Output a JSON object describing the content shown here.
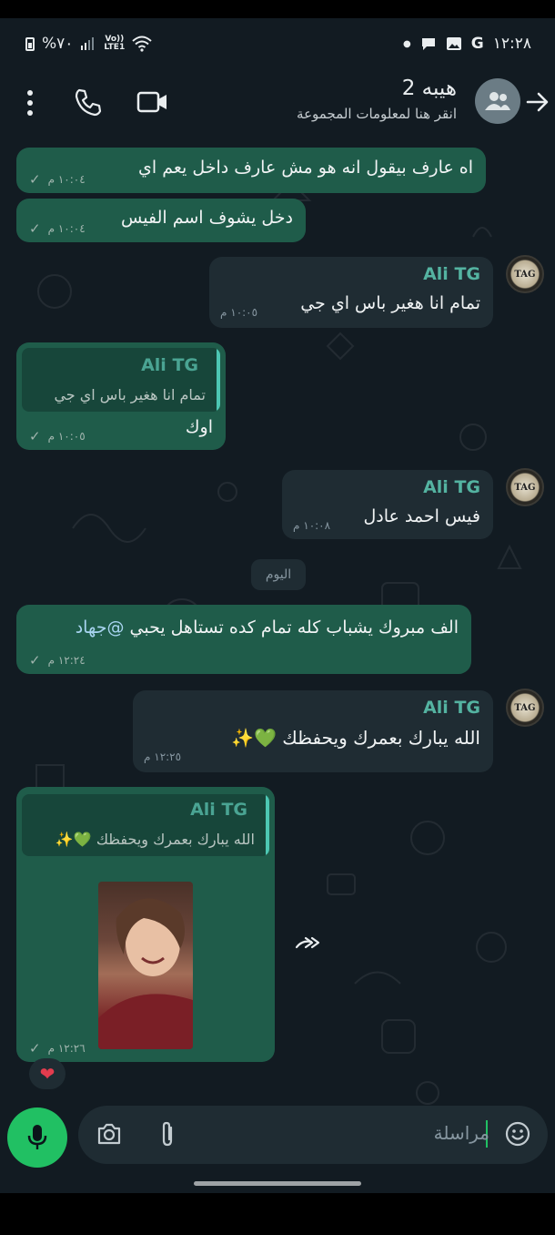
{
  "status_bar": {
    "time": "١٢:٢٨",
    "battery": "%٧٠",
    "network": "LTE1",
    "volte": "Vo))",
    "carrier_icon": "G"
  },
  "header": {
    "group_name": "هيبه 2",
    "subtitle": "انقر هنا لمعلومات المجموعة"
  },
  "messages": [
    {
      "text": "اه عارف بيقول انه هو مش عارف داخل يعم اي",
      "time": "١٠:٠٤ م"
    },
    {
      "text": "دخل يشوف اسم الفيس",
      "time": "١٠:٠٤ م"
    },
    {
      "sender": "Ali TG",
      "text": "تمام  انا هغير باس اي جي",
      "time": "١٠:٠٥ م"
    },
    {
      "quote_sender": "Ali TG",
      "quote_text": "تمام  انا هغير باس اي جي",
      "text": "اوك",
      "time": "١٠:٠٥ م"
    },
    {
      "sender": "Ali TG",
      "text": "فيس احمد عادل",
      "time": "١٠:٠٨ م"
    },
    {
      "text_before": "الف مبروك يشباب كله تمام كده تستاهل يحبي ",
      "mention": "@جهاد",
      "time": "١٢:٢٤ م"
    },
    {
      "sender": "Ali TG",
      "text": "الله يبارك بعمرك ويحفظك 💚✨",
      "time": "١٢:٢٥ م"
    },
    {
      "quote_sender": "Ali TG",
      "quote_text": "الله يبارك بعمرك ويحفظك 💚✨",
      "time": "١٢:٢٦ م",
      "reaction": "❤"
    }
  ],
  "date_separator": "اليوم",
  "avatar_label": "TAG",
  "composer": {
    "placeholder": "مراسلة"
  },
  "colors": {
    "outgoing_bubble": "#1f5c4a",
    "incoming_bubble": "#1f2c33",
    "accent_green": "#21c063",
    "sender_name": "#54b3a1"
  }
}
